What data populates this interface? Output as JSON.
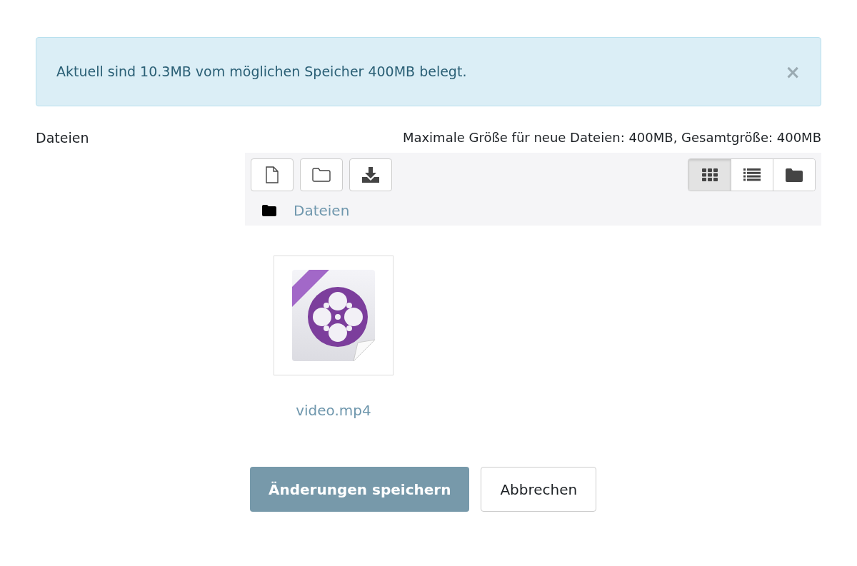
{
  "alert": {
    "text": "Aktuell sind 10.3MB vom möglichen Speicher 400MB belegt.",
    "close": "×"
  },
  "field": {
    "label": "Dateien",
    "limits": "Maximale Größe für neue Dateien: 400MB, Gesamtgröße: 400MB"
  },
  "toolbar": {
    "actions": [
      {
        "kind": "file"
      },
      {
        "kind": "folder"
      },
      {
        "kind": "download"
      }
    ],
    "views": [
      {
        "kind": "grid",
        "selected": true
      },
      {
        "kind": "list",
        "selected": false
      },
      {
        "kind": "tree",
        "selected": false
      }
    ],
    "path": "Dateien"
  },
  "files": [
    {
      "name": "video.mp4"
    }
  ],
  "buttons": [
    {
      "label": "Änderungen speichern",
      "kind": "primary"
    },
    {
      "label": "Abbrechen",
      "kind": "secondary"
    }
  ]
}
